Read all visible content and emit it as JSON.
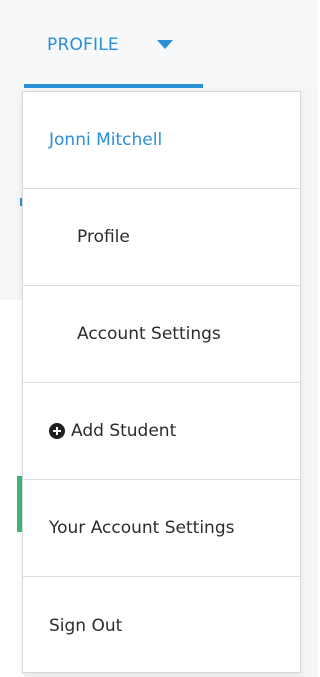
{
  "nav": {
    "profile_tab_label": "PROFILE",
    "accent_color": "#2b8fd6"
  },
  "menu": {
    "user_name": "Jonni Mitchell",
    "items": [
      {
        "label": "Profile"
      },
      {
        "label": "Account Settings"
      },
      {
        "label": "Add Student",
        "icon": "plus-circle-icon"
      },
      {
        "label": "Your Account Settings"
      },
      {
        "label": "Sign Out"
      }
    ]
  }
}
